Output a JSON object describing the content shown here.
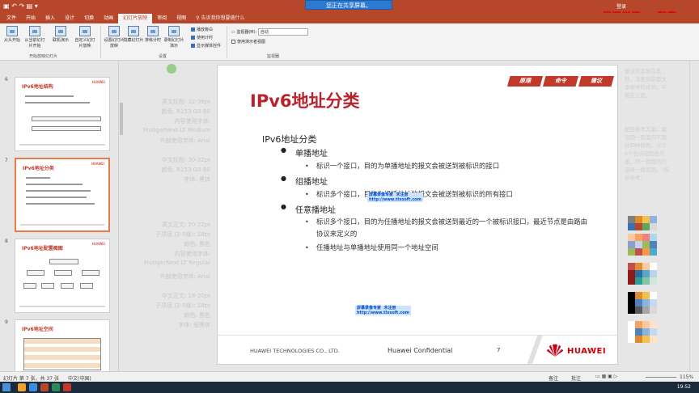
{
  "window": {
    "share_banner": "您正在共享屏幕。",
    "watermark": "武汉学天 — 阮燕",
    "login": "登录"
  },
  "tabs": [
    "文件",
    "开始",
    "插入",
    "设计",
    "切换",
    "动画",
    "幻灯片放映",
    "审阅",
    "视图"
  ],
  "tab_search": "♀ 告诉我你想要做什么",
  "ribbon": {
    "buttons": [
      "从头开始",
      "从当前幻灯片开始",
      "联机演示",
      "自定义幻灯片放映",
      "设置幻灯片放映",
      "隐藏幻灯片",
      "排练计时",
      "录制幻灯片演示"
    ],
    "checks": [
      "播放旁白",
      "使用计时",
      "显示媒体控件"
    ],
    "monitor_label": "监视器(M):",
    "monitor_value": "自动",
    "presenter_view": "使用演示者视图",
    "groups": [
      "开始放映幻灯片",
      "设置",
      "监视器"
    ]
  },
  "thumbnails": [
    {
      "num": "6",
      "title": "IPv6地址结构"
    },
    {
      "num": "7",
      "title": "IPv6地址分类"
    },
    {
      "num": "8",
      "title": "IPv6地址配置概图"
    },
    {
      "num": "9",
      "title": "IPv6地址空间"
    }
  ],
  "ghost_mid": [
    "英文标题: 32-36pt",
    "颜色: R153 G0 B0",
    "内容使用字体:",
    "FrutigerNext LT Medium",
    "外部使用字体: Arial",
    "中文标题: 30-32pt",
    "颜色: R153 G0 B0",
    "字体: 黑体",
    "英文正文: 20-22pt",
    "子项目 (2-5级): 18pt",
    "颜色: 黑色",
    "内容使用字体:",
    "FrutigerNext LT Regular",
    "外部使用字体: Arial",
    "中文正文: 18-20pt",
    "子项目 (2-5级): 18pt",
    "颜色: 黑色",
    "字体: 细黑体"
  ],
  "slide": {
    "title": "IPv6地址分类",
    "badges": [
      "原理",
      "命令",
      "建议"
    ],
    "section": "IPv6地址分类",
    "items": [
      {
        "heading": "单播地址",
        "subs": [
          "标识一个接口，目的为单播地址的报文会被送到被标识的接口"
        ]
      },
      {
        "heading": "组播地址",
        "subs": [
          "标识多个接口，目的为组播地址的报文会被送到被标识的所有接口"
        ]
      },
      {
        "heading": "任意播地址",
        "subs": [
          "标识多个接口，目的为任播地址的报文会被送到最近的一个被标识接口，最近节点是由路由协议来定义的",
          "任播地址与单播地址使用同一个地址空间"
        ]
      }
    ],
    "wm1": [
      "屏幕录像专家",
      "未注册",
      "http://www.tlxsoft.com"
    ],
    "wm2": [
      "屏幕录像专家",
      "未注册",
      "http://www.tlxsoft.com"
    ],
    "footer_company": "HUAWEI TECHNOLOGIES CO., LTD.",
    "footer_conf": "Huawei Confidential",
    "footer_page": "7",
    "footer_brand": "HUAWEI"
  },
  "ghost_right": [
    "备注信息放在此处，注意到前面文本框中的说明，不要在上面。",
    "配色参考方案：建议同一页面内不超过四种颜色，以下4个色块组配色方案，同一页面内只选择一组使用。（仅供参考）"
  ],
  "status": {
    "slide_info": "幻灯片 第 7 张，共 37 张",
    "lang": "中文(中国)",
    "notes": "备注",
    "comments": "批注",
    "zoom": "115%"
  },
  "taskbar": {
    "clock": "19:52"
  },
  "colors": {
    "accent": "#b7472a",
    "title_red": "#b8232e",
    "share": "#2b79d0"
  }
}
